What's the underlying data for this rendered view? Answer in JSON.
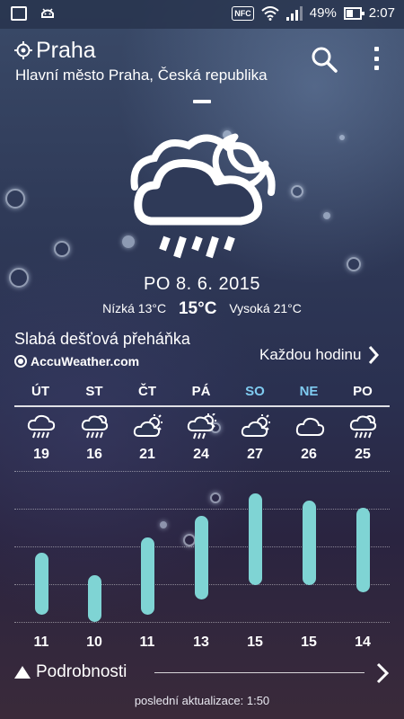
{
  "status_bar": {
    "battery": "49%",
    "time": "2:07",
    "nfc": "NFC",
    "icons": [
      "image-icon",
      "android-icon",
      "nfc-icon",
      "wifi-icon",
      "signal-icon",
      "battery-icon"
    ]
  },
  "header": {
    "city": "Praha",
    "region": "Hlavní město Praha, Česká republika",
    "icons": [
      "location-icon",
      "search-icon",
      "more-vert-icon"
    ]
  },
  "current": {
    "icon": "cloud-moon-rain-icon",
    "date": "PO 8. 6. 2015",
    "low": "Nízká 13°C",
    "temp": "15°C",
    "high": "Vysoká 21°C",
    "condition": "Slabá dešťová přeháňka",
    "provider": "AccuWeather.com",
    "hourly_link": "Každou hodinu"
  },
  "forecast": {
    "days": [
      {
        "name": "ÚT",
        "high": "19",
        "low": "11",
        "icon": "cloud-rain-icon",
        "weekend": false
      },
      {
        "name": "ST",
        "high": "16",
        "low": "10",
        "icon": "cloud-sun-rain-icon",
        "weekend": false
      },
      {
        "name": "ČT",
        "high": "21",
        "low": "11",
        "icon": "sun-cloud-icon",
        "weekend": false
      },
      {
        "name": "PÁ",
        "high": "24",
        "low": "13",
        "icon": "sun-cloud-rain-icon",
        "weekend": false
      },
      {
        "name": "SO",
        "high": "27",
        "low": "15",
        "icon": "sun-cloud-icon",
        "weekend": true
      },
      {
        "name": "NE",
        "high": "26",
        "low": "15",
        "icon": "cloud-icon",
        "weekend": true
      },
      {
        "name": "PO",
        "high": "25",
        "low": "14",
        "icon": "cloud-sun-rain-icon",
        "weekend": false
      }
    ],
    "bar_color": "#7fd4d4",
    "weekend_color": "#7fcbf0"
  },
  "footer": {
    "details": "Podrobnosti",
    "updated": "poslední aktualizace: 1:50"
  }
}
